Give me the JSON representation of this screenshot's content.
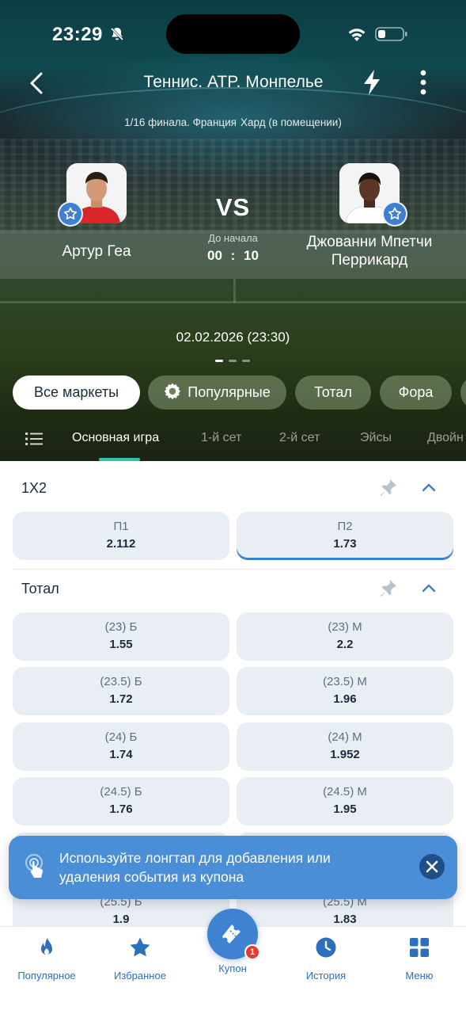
{
  "status_bar": {
    "time": "23:29"
  },
  "header": {
    "title": "Теннис. ATP. Монпелье",
    "stage": "1/16 финала. Франция",
    "surface": "Хард (в помещении)"
  },
  "match": {
    "player1": "Артур Геа",
    "player2": "Джованни Мпетчи Перрикард",
    "vs": "VS",
    "countdown_label": "До начала",
    "countdown": "00 : 10",
    "date": "02.02.2026 (23:30)"
  },
  "filter_chips": [
    "Все маркеты",
    "Популярные",
    "Тотал",
    "Фора"
  ],
  "tabs": [
    "Основная игра",
    "1-й сет",
    "2-й сет",
    "Эйсы",
    "Двойн"
  ],
  "markets": {
    "x12": {
      "title": "1X2",
      "odds": [
        {
          "label": "П1",
          "value": "2.112"
        },
        {
          "label": "П2",
          "value": "1.73"
        }
      ]
    },
    "total": {
      "title": "Тотал",
      "rows": [
        [
          {
            "label": "(23) Б",
            "value": "1.55"
          },
          {
            "label": "(23) М",
            "value": "2.2"
          }
        ],
        [
          {
            "label": "(23.5) Б",
            "value": "1.72"
          },
          {
            "label": "(23.5) М",
            "value": "1.96"
          }
        ],
        [
          {
            "label": "(24) Б",
            "value": "1.74"
          },
          {
            "label": "(24) М",
            "value": "1.952"
          }
        ],
        [
          {
            "label": "(24.5) Б",
            "value": "1.76"
          },
          {
            "label": "(24.5) М",
            "value": "1.95"
          }
        ],
        [
          {
            "label": "(25.5) Б",
            "value": "1.9"
          },
          {
            "label": "(25.5) М",
            "value": "1.83"
          }
        ]
      ]
    }
  },
  "toast": {
    "text": "Используйте лонгтап для добавления или удаления события из купона"
  },
  "bottom_nav": {
    "popular": "Популярное",
    "favorites": "Избранное",
    "coupon": "Купон",
    "coupon_badge": "1",
    "history": "История",
    "menu": "Меню"
  },
  "colors": {
    "accent": "#3f82d2",
    "tab_underline": "#2fc2a8",
    "badge": "#e53935"
  }
}
